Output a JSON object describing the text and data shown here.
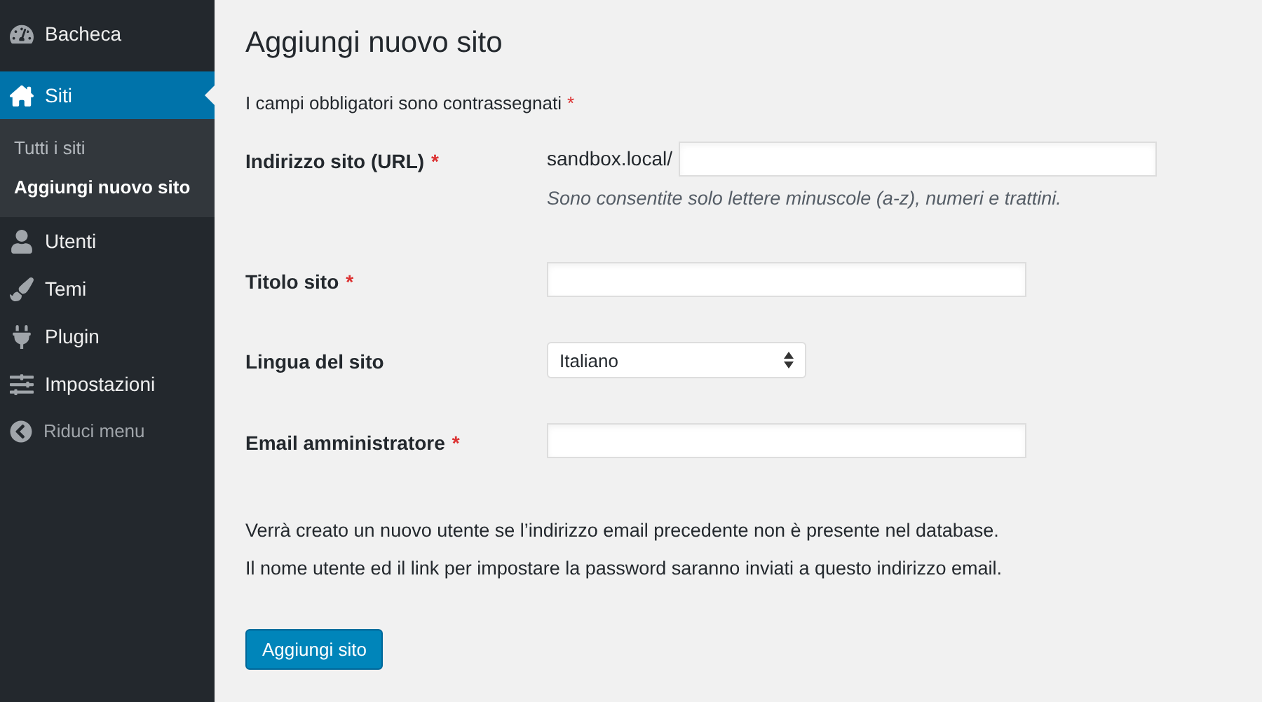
{
  "sidebar": {
    "items": [
      {
        "label": "Bacheca",
        "selected": false
      },
      {
        "label": "Siti",
        "selected": true,
        "children": [
          {
            "label": "Tutti i siti",
            "selected": false
          },
          {
            "label": "Aggiungi nuovo sito",
            "selected": true
          }
        ]
      },
      {
        "label": "Utenti",
        "selected": false
      },
      {
        "label": "Temi",
        "selected": false
      },
      {
        "label": "Plugin",
        "selected": false
      },
      {
        "label": "Impostazioni",
        "selected": false
      }
    ],
    "collapse_menu": "Riduci menu"
  },
  "page_title": "Aggiungi nuovo sito",
  "required_note": {
    "text": "I campi obbligatori sono contrassegnati",
    "mark": "*"
  },
  "fields": [
    {
      "kind": "prefixed",
      "label": "Indirizzo sito (URL)",
      "required_mark": "*",
      "prefix": "sandbox.local/",
      "hint": "Sono consentite solo lettere minuscole (a-z), numeri e trattini."
    },
    {
      "kind": "text",
      "label": "Titolo sito",
      "required_mark": "*"
    },
    {
      "kind": "select",
      "label": "Lingua del sito",
      "value": "Italiano"
    },
    {
      "kind": "text",
      "label": "Email amministratore",
      "required_mark": "*"
    }
  ],
  "notice": [
    "Verrà creato un nuovo utente se l’indirizzo email precedente non è presente nel database.",
    "Il nome utente ed il link per impostare la password saranno inviati a questo indirizzo email."
  ],
  "submit": "Aggiungi sito"
}
